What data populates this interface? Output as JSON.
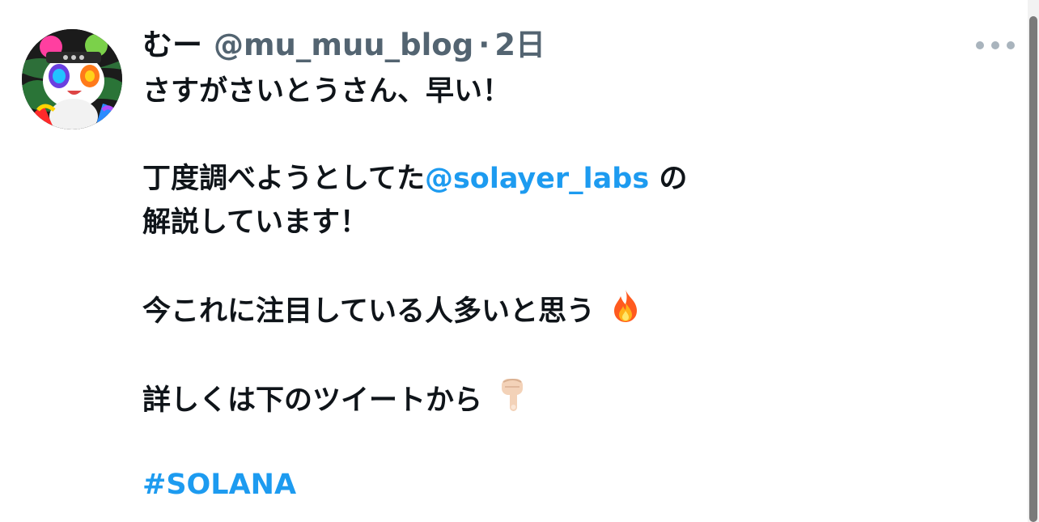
{
  "tweet": {
    "display_name": "むー",
    "handle": "@mu_muu_blog",
    "separator": "·",
    "time": "2日",
    "more_icon": "more-horizontal-icon",
    "lines": {
      "l1": "さすがさいとうさん、早い！",
      "l2_pre": "丁度調べようとしてた",
      "l2_mention": "@solayer_labs",
      "l2_post": " の",
      "l3": "解説しています！",
      "l4": "今これに注目している人多いと思う",
      "l5": "詳しくは下のツイートから",
      "hashtag": "#SOLANA"
    },
    "emojis": {
      "fire": "fire-emoji",
      "pointing_down": "backhand-index-pointing-down-emoji"
    }
  },
  "colors": {
    "link": "#1d9bf0",
    "text": "#0f1419",
    "muted": "#536471"
  }
}
